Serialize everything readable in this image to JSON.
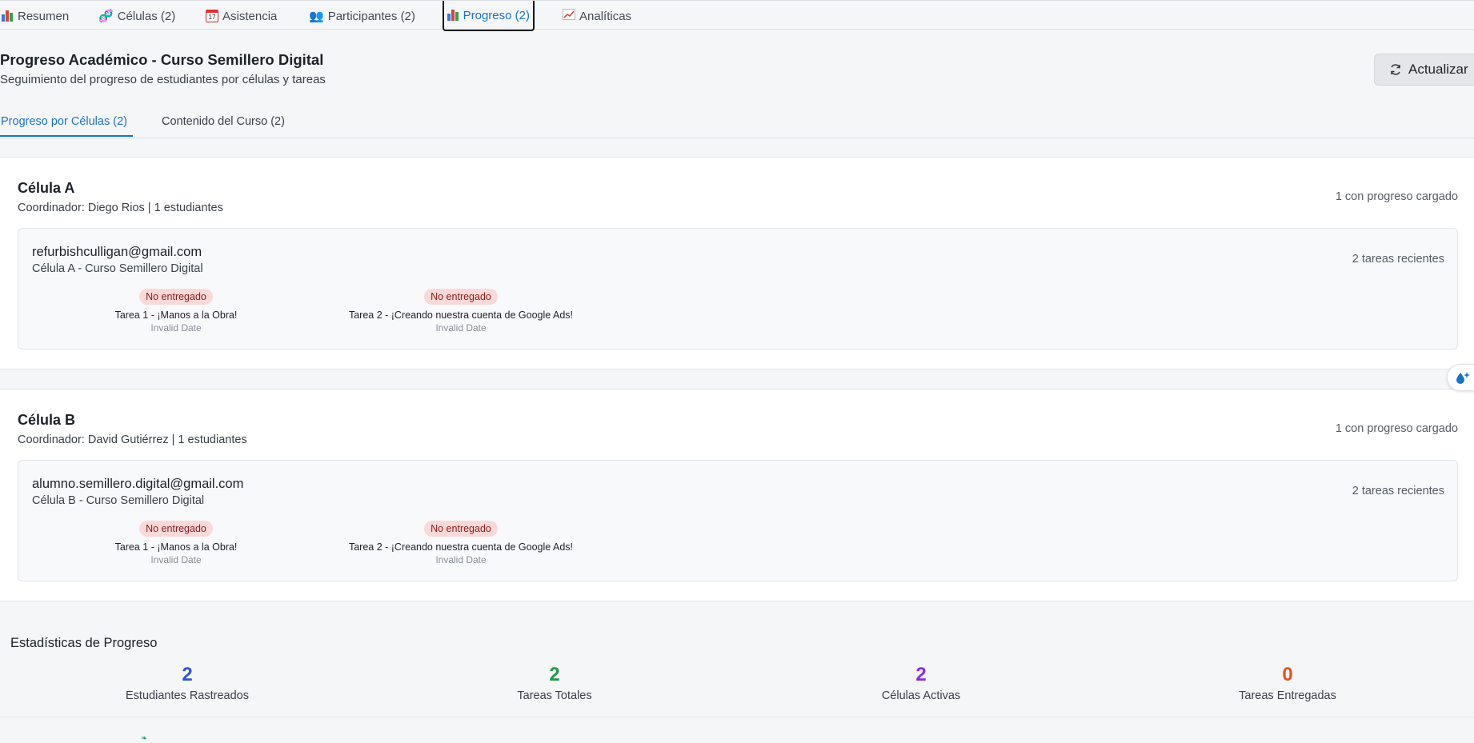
{
  "topnav": {
    "tabs": [
      {
        "label": "Resumen",
        "icon": "bar-chart-icon"
      },
      {
        "label": "Células (2)",
        "icon": "dna-icon"
      },
      {
        "label": "Asistencia",
        "icon": "calendar-icon"
      },
      {
        "label": "Participantes (2)",
        "icon": "people-icon"
      },
      {
        "label": "Progreso (2)",
        "icon": "bar-chart-icon",
        "active": true
      },
      {
        "label": "Analíticas",
        "icon": "trend-chart-icon"
      }
    ],
    "icons": {
      "calendar_day": "17"
    }
  },
  "header": {
    "title": "Progreso Académico - Curso Semillero Digital",
    "subtitle": "Seguimiento del progreso de estudiantes por células y tareas",
    "refresh_label": "Actualizar"
  },
  "subtabs": [
    {
      "label": "Progreso por Células (2)",
      "active": true
    },
    {
      "label": "Contenido del Curso (2)"
    }
  ],
  "cells": [
    {
      "name": "Célula A",
      "meta": "Coordinador: Diego Rios | 1 estudiantes",
      "progress_summary": "1 con progreso cargado",
      "student": {
        "email": "refurbishculligan@gmail.com",
        "cell_course": "Célula A - Curso Semillero Digital",
        "recent": "2 tareas recientes",
        "tasks": [
          {
            "status": "No entregado",
            "name": "Tarea 1 - ¡Manos a la Obra!",
            "date": "Invalid Date"
          },
          {
            "status": "No entregado",
            "name": "Tarea 2 - ¡Creando nuestra cuenta de Google Ads!",
            "date": "Invalid Date"
          }
        ]
      }
    },
    {
      "name": "Célula B",
      "meta": "Coordinador: David Gutiérrez | 1 estudiantes",
      "progress_summary": "1 con progreso cargado",
      "student": {
        "email": "alumno.semillero.digital@gmail.com",
        "cell_course": "Célula B - Curso Semillero Digital",
        "recent": "2 tareas recientes",
        "tasks": [
          {
            "status": "No entregado",
            "name": "Tarea 1 - ¡Manos a la Obra!",
            "date": "Invalid Date"
          },
          {
            "status": "No entregado",
            "name": "Tarea 2 - ¡Creando nuestra cuenta de Google Ads!",
            "date": "Invalid Date"
          }
        ]
      }
    }
  ],
  "stats": {
    "title": "Estadísticas de Progreso",
    "items": [
      {
        "value": "2",
        "label": "Estudiantes Rastreados",
        "color": "#2f55d4"
      },
      {
        "value": "2",
        "label": "Tareas Totales",
        "color": "#1f9a4a"
      },
      {
        "value": "2",
        "label": "Células Activas",
        "color": "#8a2be2"
      },
      {
        "value": "0",
        "label": "Tareas Entregadas",
        "color": "#e0531f"
      }
    ]
  },
  "colors": {
    "accent": "#1a73c9",
    "badge_bg": "#fbd9d9",
    "badge_text": "#8b1a1a"
  }
}
